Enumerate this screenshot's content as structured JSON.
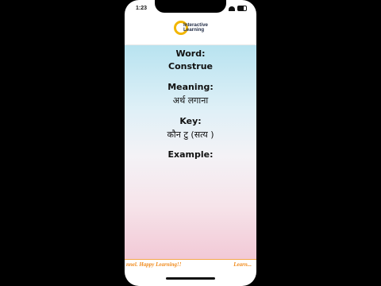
{
  "status_bar": {
    "time": "1:23"
  },
  "header": {
    "logo_line1": "Interactive",
    "logo_line2": "Learning"
  },
  "card": {
    "word_label": "Word:",
    "word_value": "Construe",
    "meaning_label": "Meaning:",
    "meaning_value": "अर्थ लगाना",
    "key_label": "Key:",
    "key_value": "कौन टु (सत्य )",
    "example_label": "Example:",
    "example_value": ""
  },
  "footer": {
    "ticker_left": "nnel. Happy Learning!!",
    "ticker_right": "Learn..."
  },
  "colors": {
    "accent_orange": "#f08a1b",
    "logo_yellow": "#f2b600"
  }
}
